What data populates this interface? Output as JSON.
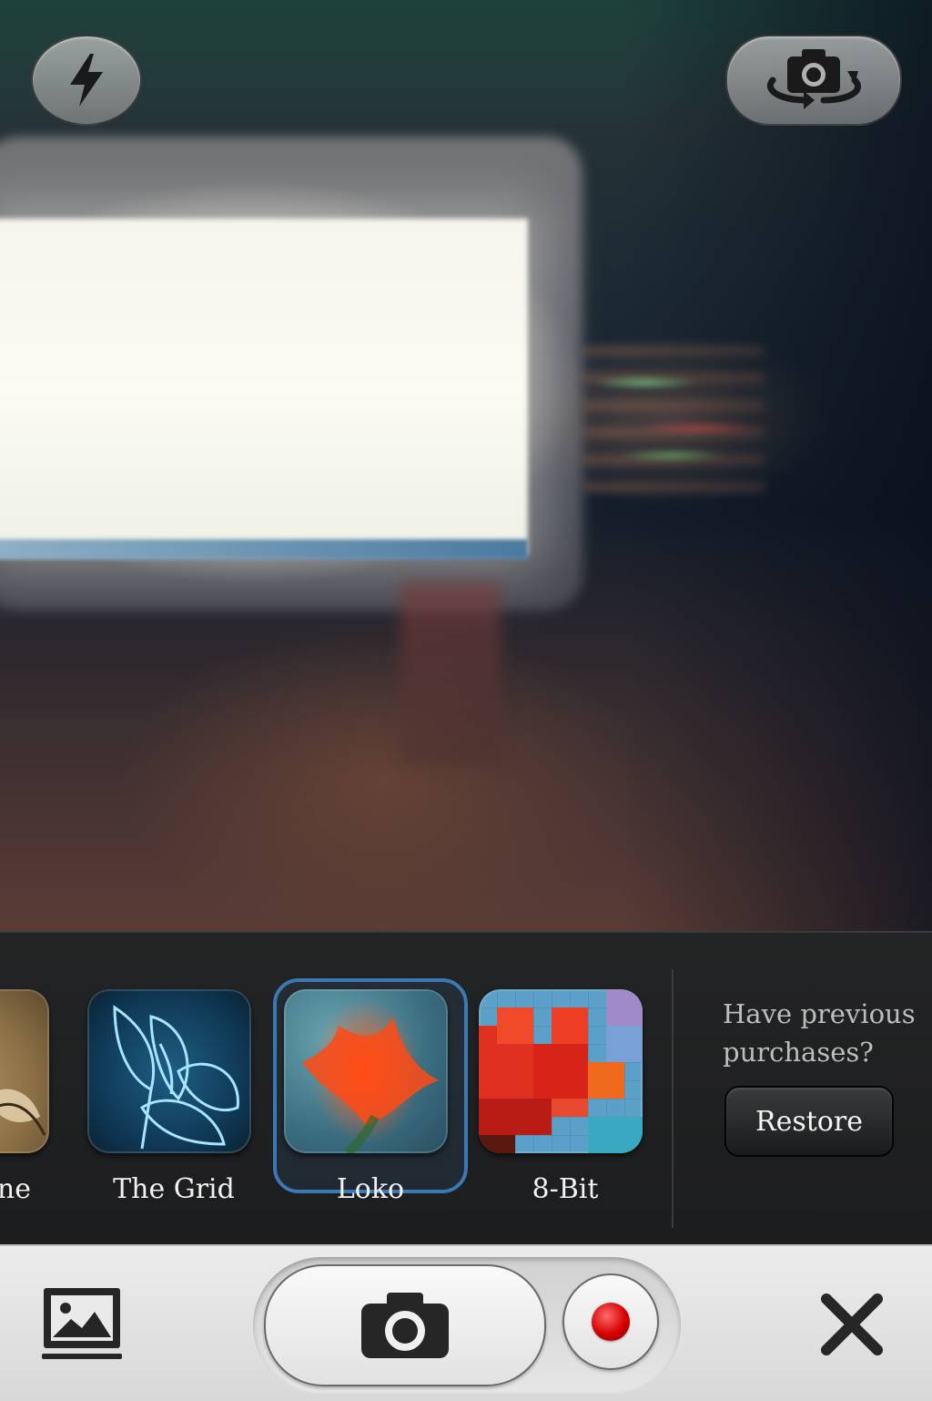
{
  "viewfinder": {
    "flash_icon": "lightning-bolt-icon",
    "switch_camera_icon": "camera-rotate-icon"
  },
  "filters": [
    {
      "label": "ne",
      "thumb": "sepia-flower",
      "selected": false
    },
    {
      "label": "The Grid",
      "thumb": "blue-wireframe-flower",
      "selected": false
    },
    {
      "label": "Loko",
      "thumb": "blurred-orange-flower",
      "selected": true
    },
    {
      "label": "8-Bit",
      "thumb": "pixelated-red-flower",
      "selected": false
    }
  ],
  "purchases": {
    "prompt_line1": "Have previous",
    "prompt_line2": "purchases?",
    "restore_label": "Restore"
  },
  "toolbar": {
    "gallery_icon": "photo-gallery-icon",
    "shutter_icon": "camera-icon",
    "record_icon": "record-dot-icon",
    "close_icon": "close-x-icon"
  },
  "colors": {
    "selected_ring": "#3c78b4",
    "record_red": "#d40000",
    "tray_bg": "#1c1d1e",
    "toolbar_bg": "#e0e0e0"
  }
}
